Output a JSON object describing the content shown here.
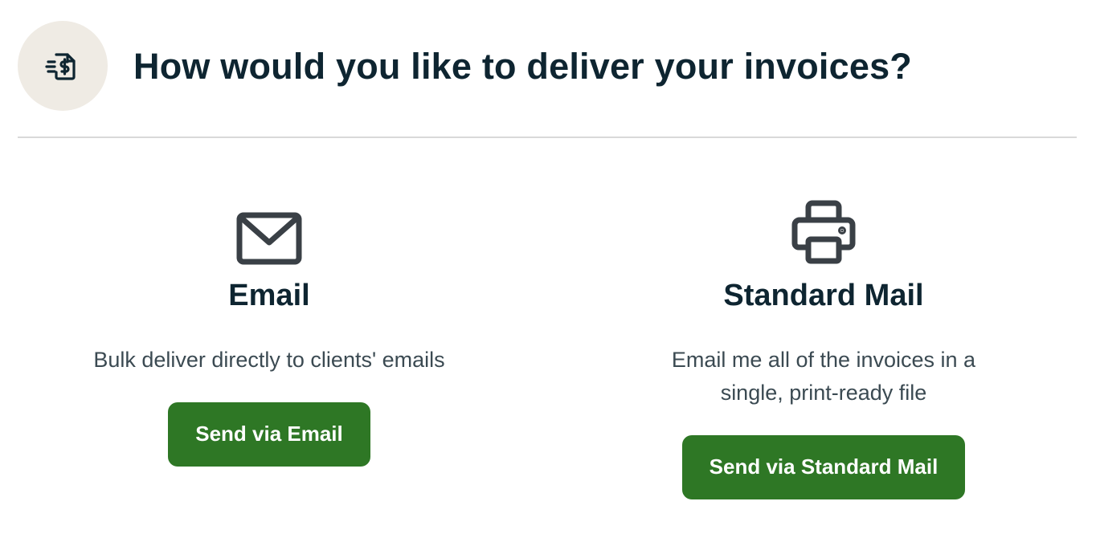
{
  "header": {
    "icon": "invoice-dollar-icon",
    "title": "How would you like to deliver your invoices?"
  },
  "options": [
    {
      "icon": "envelope-icon",
      "title": "Email",
      "description": "Bulk deliver directly to clients' emails",
      "button_label": "Send via Email"
    },
    {
      "icon": "printer-icon",
      "title": "Standard Mail",
      "description": "Email me all of the invoices in a single, print-ready file",
      "button_label": "Send via Standard Mail"
    }
  ],
  "colors": {
    "primary_button": "#2e7725",
    "title_text": "#0e2531",
    "body_text": "#3b4a52",
    "icon": "#3a4046",
    "icon_circle_bg": "#efebe4",
    "divider": "#d9d9d9"
  }
}
